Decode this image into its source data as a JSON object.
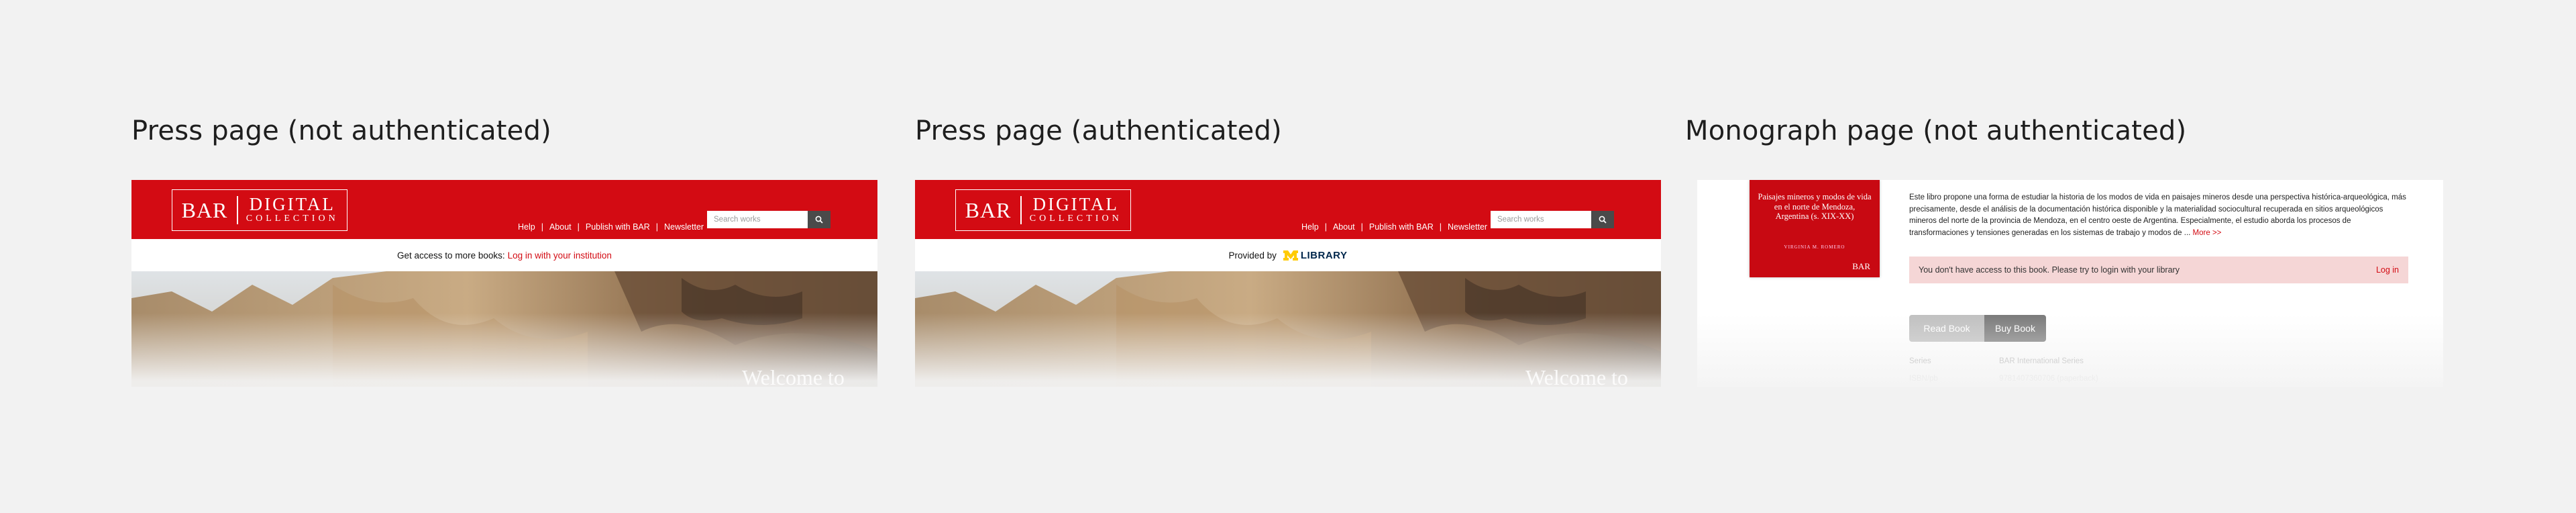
{
  "panels": [
    {
      "heading": "Press page (not authenticated)",
      "logo": {
        "bar": "BAR",
        "line1": "DIGITAL",
        "line2": "COLLECTION"
      },
      "nav": [
        "Help",
        "About",
        "Publish with BAR",
        "Newsletter"
      ],
      "search_placeholder": "Search works",
      "access_text": "Get access to more books:",
      "access_link": "Log in with your institution",
      "hero_text": "Welcome to"
    },
    {
      "heading": "Press page (authenticated)",
      "logo": {
        "bar": "BAR",
        "line1": "DIGITAL",
        "line2": "COLLECTION"
      },
      "nav": [
        "Help",
        "About",
        "Publish with BAR",
        "Newsletter"
      ],
      "search_placeholder": "Search works",
      "provided_by": "Provided by",
      "library_name": "LIBRARY",
      "hero_text": "Welcome to"
    },
    {
      "heading": "Monograph page (not authenticated)",
      "cover": {
        "title": "Paisajes mineros y modos de vida en el norte de Mendoza, Argentina (s. XIX-XX)",
        "author": "VIRGINIA M. ROMERO",
        "publisher": "BAR"
      },
      "description": "Este libro propone una forma de estudiar la historia de los modos de vida en paisajes mineros desde una perspectiva histórica-arqueológica, más precisamente, desde el análisis de la documentación histórica disponible y la materialidad sociocultural recuperada en sitios arqueológicos mineros del norte de la provincia de Mendoza, en el centro oeste de Argentina. Especialmente, el estudio aborda los procesos de transformaciones y tensiones generadas en los sistemas de trabajo y modos de ...",
      "more_link": "More >>",
      "alert_text": "You don't have access to this book. Please try to login with your library",
      "alert_login": "Log in",
      "read_button": "Read Book",
      "buy_button": "Buy Book",
      "meta_series_label": "Series",
      "meta_series_value": "BAR International Series",
      "meta_isbn_label": "ISBN/pb",
      "meta_isbn_value": "9781407360706 (paperback)"
    }
  ],
  "colors": {
    "brand_red": "#d30b13",
    "alert_bg": "#f5d6d6",
    "page_bg": "#f2f2f2"
  }
}
